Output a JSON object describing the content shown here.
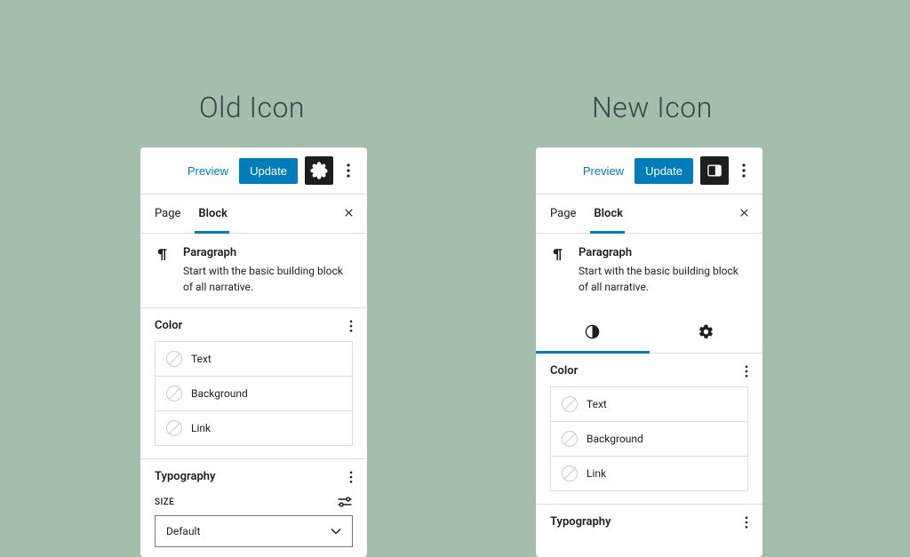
{
  "labels": {
    "old": "Old Icon",
    "new": "New Icon"
  },
  "panels": {
    "old": {
      "toolbar": {
        "preview": "Preview",
        "update": "Update"
      },
      "tabs": {
        "page": "Page",
        "block": "Block"
      },
      "block": {
        "name": "Paragraph",
        "description": "Start with the basic building block of all narrative."
      },
      "color": {
        "title": "Color",
        "items": [
          "Text",
          "Background",
          "Link"
        ]
      },
      "typography": {
        "title": "Typography",
        "size_label": "SIZE",
        "dropdown_value": "Default"
      }
    },
    "new": {
      "toolbar": {
        "preview": "Preview",
        "update": "Update"
      },
      "tabs": {
        "page": "Page",
        "block": "Block"
      },
      "block": {
        "name": "Paragraph",
        "description": "Start with the basic building block of all narrative."
      },
      "color": {
        "title": "Color",
        "items": [
          "Text",
          "Background",
          "Link"
        ]
      },
      "typography": {
        "title": "Typography"
      }
    }
  }
}
